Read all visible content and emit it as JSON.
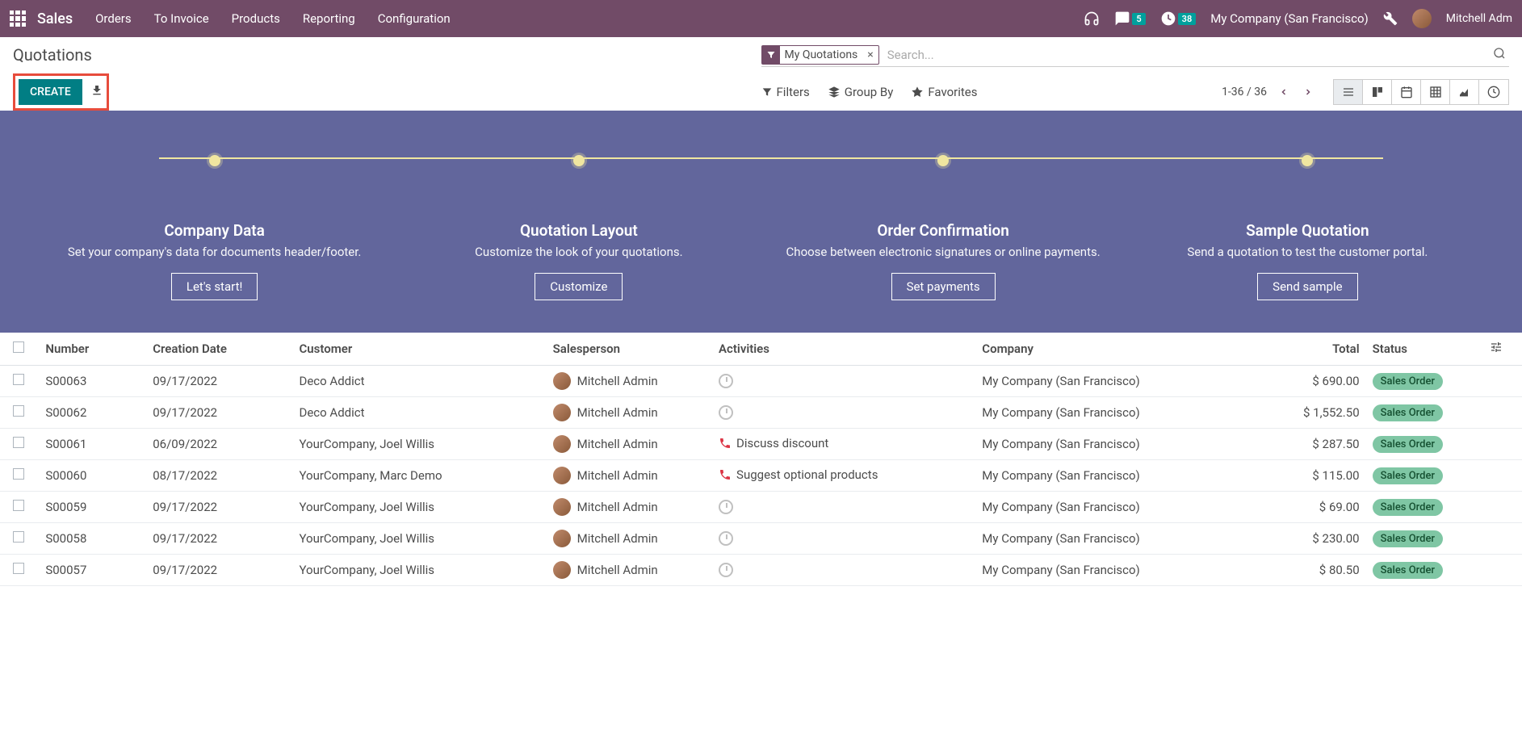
{
  "topnav": {
    "brand": "Sales",
    "menu": [
      "Orders",
      "To Invoice",
      "Products",
      "Reporting",
      "Configuration"
    ],
    "messages_count": "5",
    "activities_count": "38",
    "company": "My Company (San Francisco)",
    "user": "Mitchell Adm"
  },
  "breadcrumb": "Quotations",
  "search": {
    "facet_label": "My Quotations",
    "placeholder": "Search..."
  },
  "buttons": {
    "create": "CREATE"
  },
  "search_opts": {
    "filters": "Filters",
    "groupby": "Group By",
    "favorites": "Favorites"
  },
  "pager": "1-36 / 36",
  "banner": {
    "steps": [
      {
        "title": "Company Data",
        "desc": "Set your company's data for documents header/footer.",
        "btn": "Let's start!"
      },
      {
        "title": "Quotation Layout",
        "desc": "Customize the look of your quotations.",
        "btn": "Customize"
      },
      {
        "title": "Order Confirmation",
        "desc": "Choose between electronic signatures or online payments.",
        "btn": "Set payments"
      },
      {
        "title": "Sample Quotation",
        "desc": "Send a quotation to test the customer portal.",
        "btn": "Send sample"
      }
    ]
  },
  "table": {
    "headers": {
      "number": "Number",
      "date": "Creation Date",
      "customer": "Customer",
      "salesperson": "Salesperson",
      "activities": "Activities",
      "company": "Company",
      "total": "Total",
      "status": "Status"
    },
    "rows": [
      {
        "number": "S00063",
        "date": "09/17/2022",
        "customer": "Deco Addict",
        "sp": "Mitchell Admin",
        "activity_type": "clock",
        "activity_text": "",
        "company": "My Company (San Francisco)",
        "total": "$ 690.00",
        "status": "Sales Order"
      },
      {
        "number": "S00062",
        "date": "09/17/2022",
        "customer": "Deco Addict",
        "sp": "Mitchell Admin",
        "activity_type": "clock",
        "activity_text": "",
        "company": "My Company (San Francisco)",
        "total": "$ 1,552.50",
        "status": "Sales Order"
      },
      {
        "number": "S00061",
        "date": "06/09/2022",
        "customer": "YourCompany, Joel Willis",
        "sp": "Mitchell Admin",
        "activity_type": "phone",
        "activity_text": "Discuss discount",
        "company": "My Company (San Francisco)",
        "total": "$ 287.50",
        "status": "Sales Order"
      },
      {
        "number": "S00060",
        "date": "08/17/2022",
        "customer": "YourCompany, Marc Demo",
        "sp": "Mitchell Admin",
        "activity_type": "phone",
        "activity_text": "Suggest optional products",
        "company": "My Company (San Francisco)",
        "total": "$ 115.00",
        "status": "Sales Order"
      },
      {
        "number": "S00059",
        "date": "09/17/2022",
        "customer": "YourCompany, Joel Willis",
        "sp": "Mitchell Admin",
        "activity_type": "clock",
        "activity_text": "",
        "company": "My Company (San Francisco)",
        "total": "$ 69.00",
        "status": "Sales Order"
      },
      {
        "number": "S00058",
        "date": "09/17/2022",
        "customer": "YourCompany, Joel Willis",
        "sp": "Mitchell Admin",
        "activity_type": "clock",
        "activity_text": "",
        "company": "My Company (San Francisco)",
        "total": "$ 230.00",
        "status": "Sales Order"
      },
      {
        "number": "S00057",
        "date": "09/17/2022",
        "customer": "YourCompany, Joel Willis",
        "sp": "Mitchell Admin",
        "activity_type": "clock",
        "activity_text": "",
        "company": "My Company (San Francisco)",
        "total": "$ 80.50",
        "status": "Sales Order"
      }
    ]
  }
}
